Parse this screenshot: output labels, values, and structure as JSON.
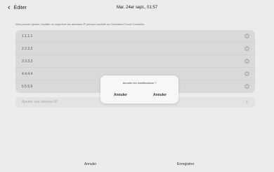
{
  "header": {
    "back_icon": "chevron-left-icon",
    "back_label": "Éditer",
    "title": "Mar. 24er sept., 01:57"
  },
  "description": "Vous pouvez ajouter, modifier ou supprimer les adresses IP pouvant accéder au Centralized Touch Controller.",
  "ip_list": [
    {
      "address": "1.1.1.1"
    },
    {
      "address": "2.2.2.2"
    },
    {
      "address": "3.3.3.3"
    },
    {
      "address": "4.4.4.4"
    },
    {
      "address": "5.5.5.5"
    }
  ],
  "add_ip": {
    "placeholder": "Ajouter une adresse IP",
    "icon": "plus-icon"
  },
  "footer": {
    "cancel_label": "Annuler",
    "save_label": "Enregistrer"
  },
  "dialog": {
    "message": "Annuler les modifications ?",
    "button_1": "Annuler",
    "button_2": "Annuler"
  }
}
